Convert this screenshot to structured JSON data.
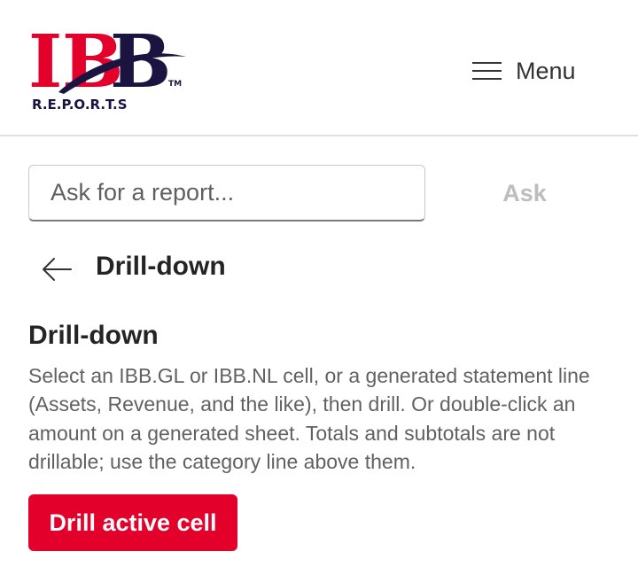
{
  "header": {
    "logo_text": "IBB",
    "logo_subtext": "R.E.P.O.R.T.S",
    "logo_trademark": "TM",
    "menu_label": "Menu"
  },
  "search": {
    "placeholder": "Ask for a report...",
    "value": "",
    "ask_label": "Ask"
  },
  "nav": {
    "page_title": "Drill-down"
  },
  "section": {
    "title": "Drill-down",
    "description": "Select an IBB.GL or IBB.NL cell, or a generated statement line (Assets, Revenue, and the like), then drill. Or double-click an amount on a generated sheet. Totals and subtotals are not drillable; use the category line above them.",
    "button_label": "Drill active cell"
  },
  "colors": {
    "brand_red": "#e3002b",
    "brand_navy": "#1c1440",
    "disabled_text": "#bdbdbd"
  },
  "icons": {
    "menu": "hamburger-icon",
    "back": "arrow-left-icon"
  }
}
